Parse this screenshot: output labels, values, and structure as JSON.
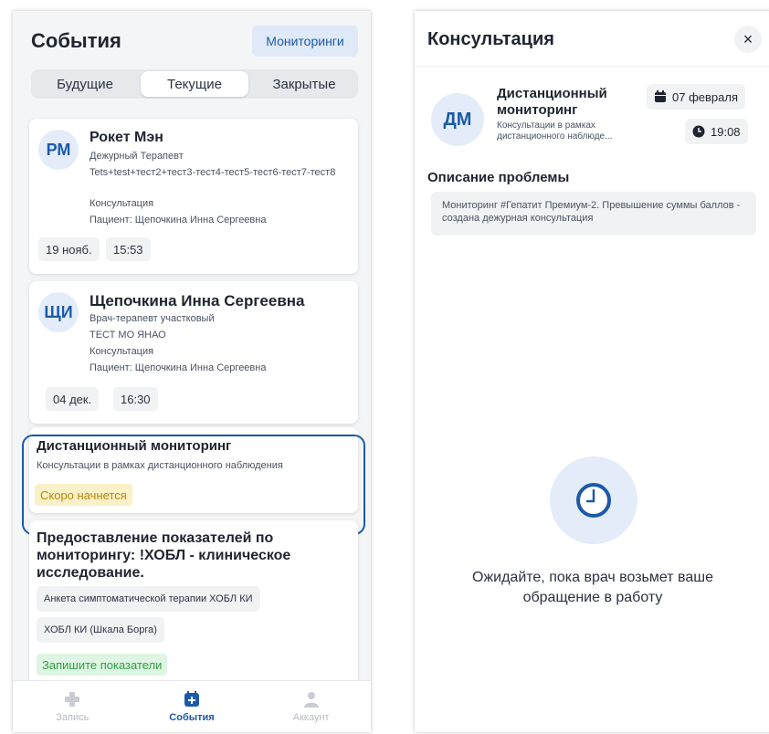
{
  "left": {
    "title": "События",
    "monitoring_button": "Мониторинги",
    "tabs": [
      {
        "label": "Будущие",
        "active": false
      },
      {
        "label": "Текущие",
        "active": true
      },
      {
        "label": "Закрытые",
        "active": false
      }
    ],
    "cards": [
      {
        "initials": "РМ",
        "name": "Рокет Мэн",
        "role": "Дежурный Терапевт",
        "note": "Tets+test+тест2+тест3-тест4-тест5-тест6-тест7-тест8",
        "type": "Консультация",
        "patient": "Пациент: Щепочкина Инна Сергеевна",
        "date": "19 нояб.",
        "time": "15:53"
      },
      {
        "initials": "ЩИ",
        "name": "Щепочкина Инна Сергеевна",
        "role": "Врач-терапевт участковый",
        "org": "ТЕСТ МО ЯНАО",
        "type": "Консультация",
        "patient": "Пациент: Щепочкина Инна Сергеевна",
        "date": "04 дек.",
        "time": "16:30"
      }
    ],
    "remote": {
      "title": "Дистанционный мониторинг",
      "subtitle": "Консультации в рамках дистанционного наблюдения",
      "badge": "Скоро начнется"
    },
    "indicators": {
      "title": "Предоставление показателей по мониторингу: !ХОБЛ - клиническое исследование.",
      "items": [
        "Анкета симптоматической терапии ХОБЛ КИ",
        "ХОБЛ КИ (Шкала Борга)"
      ],
      "badge": "Запишите показатели"
    },
    "nav": [
      {
        "label": "Запись",
        "icon": "plus-icon",
        "active": false
      },
      {
        "label": "События",
        "icon": "medical-calendar-icon",
        "active": true
      },
      {
        "label": "Аккаунт",
        "icon": "user-icon",
        "active": false
      }
    ]
  },
  "right": {
    "title": "Консультация",
    "close": "×",
    "initials": "ДМ",
    "name": "Дистанционный мониторинг",
    "subtitle": "Консультации в рамках дистанционного наблюде...",
    "date": "07 февраля",
    "time": "19:08",
    "problem_heading": "Описание проблемы",
    "problem_text": "Мониторинг #Гепатит Премиум-2. Превышение суммы баллов - создана дежурная консультация",
    "waiting_text": "Ожидайте, пока врач возьмет ваше обращение в работу"
  },
  "colors": {
    "accent": "#1c5aa8",
    "warn_bg": "#fbf1c8",
    "ok_bg": "#dff5e3"
  }
}
